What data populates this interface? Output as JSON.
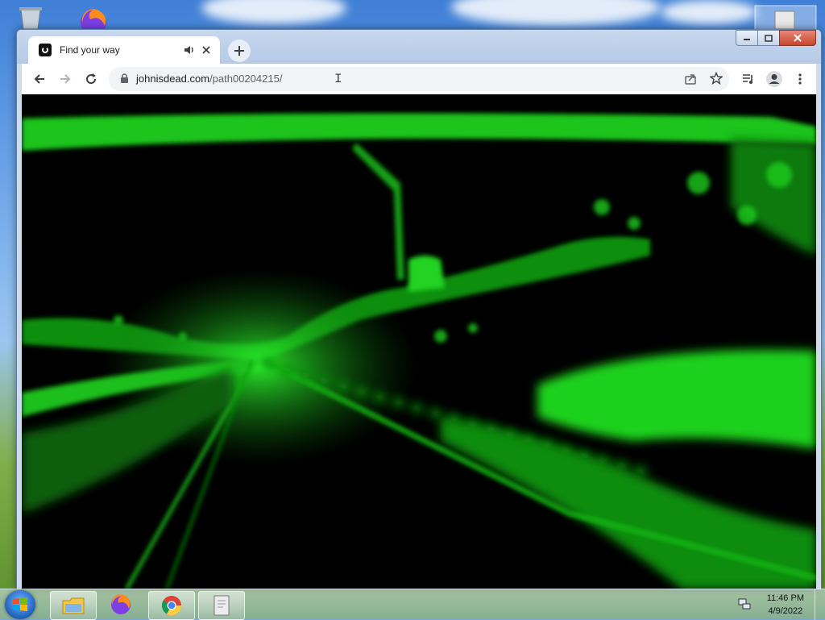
{
  "desktop": {
    "icons": [
      "recycle-bin-icon",
      "firefox-icon",
      "document-icon"
    ]
  },
  "browser": {
    "tab": {
      "title": "Find your way"
    },
    "address_bar": {
      "domain": "johnisdead.com",
      "path": "/path00204215/"
    },
    "colors": {
      "content_accent": "#1fd11f",
      "content_bg": "#000000"
    }
  },
  "taskbar": {
    "items": [
      "file-explorer-icon",
      "firefox-icon",
      "chrome-icon",
      "document-icon"
    ],
    "clock": {
      "time": "11:46 PM",
      "date": "4/9/2022"
    }
  }
}
